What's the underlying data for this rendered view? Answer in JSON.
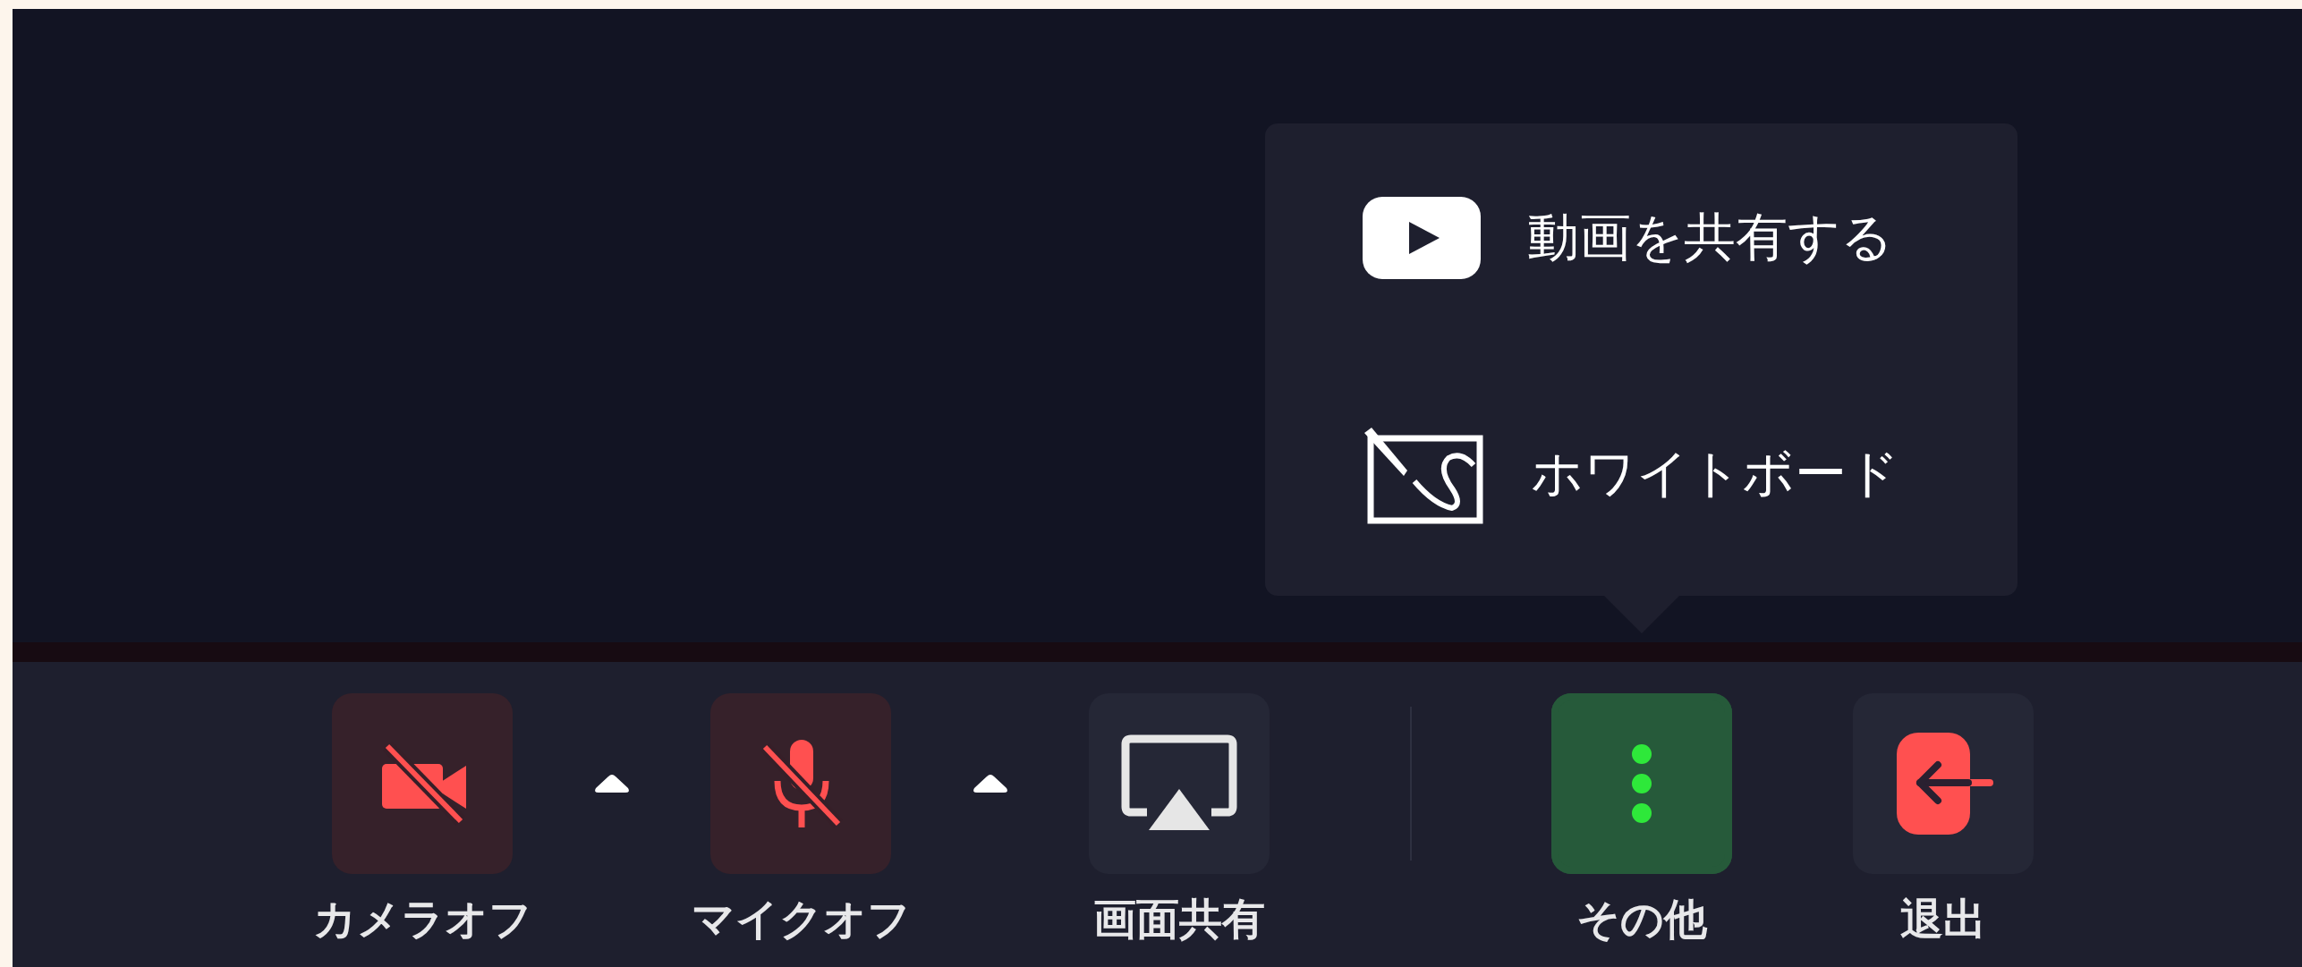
{
  "popup_menu": {
    "items": [
      {
        "kind": "video",
        "label": "動画を共有する"
      },
      {
        "kind": "whiteboard",
        "label": "ホワイトボード"
      }
    ]
  },
  "toolbar": {
    "buttons": [
      {
        "kind": "camera",
        "label": "カメラオフ",
        "muted": true,
        "selected": false,
        "has_menu": true
      },
      {
        "kind": "mic",
        "label": "マイクオフ",
        "muted": true,
        "selected": false,
        "has_menu": true
      },
      {
        "kind": "share",
        "label": "画面共有",
        "muted": false,
        "selected": false,
        "has_menu": false
      },
      {
        "kind": "more",
        "label": "その他",
        "muted": false,
        "selected": true,
        "has_menu": false
      },
      {
        "kind": "leave",
        "label": "退出",
        "muted": false,
        "selected": false,
        "has_menu": false
      }
    ]
  }
}
